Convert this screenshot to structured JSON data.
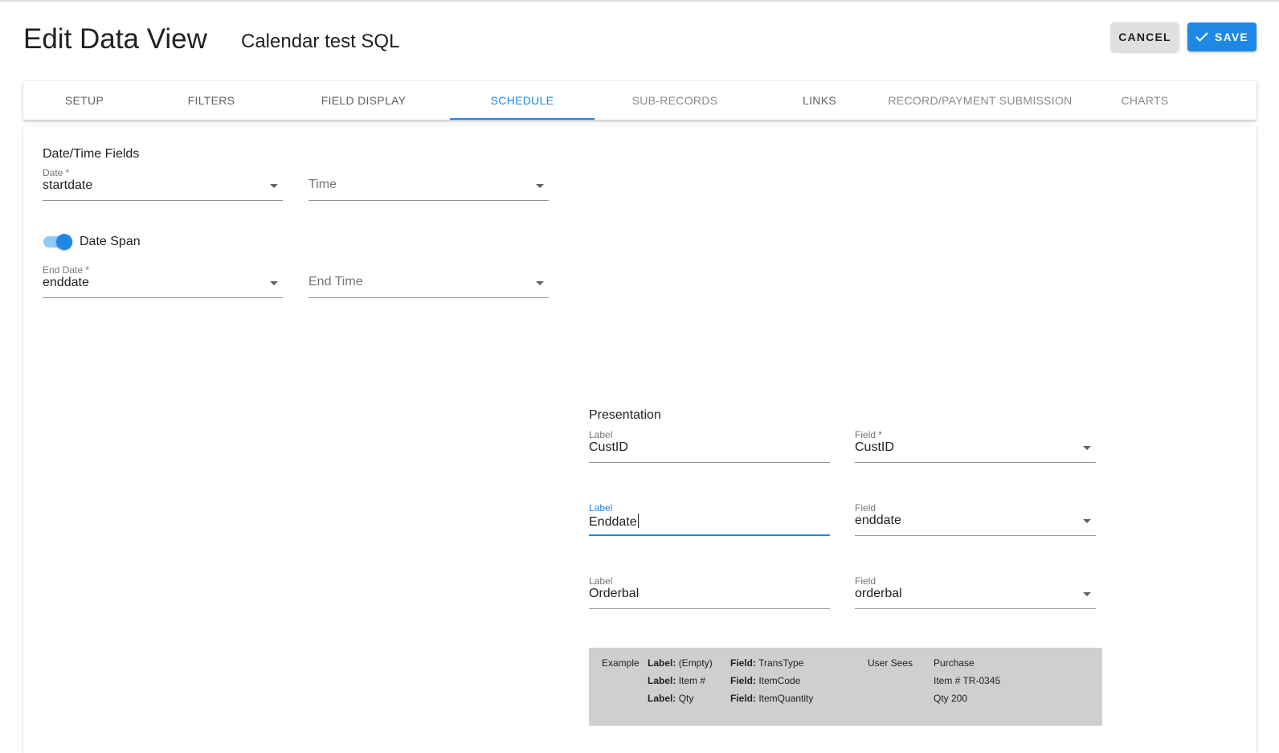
{
  "header": {
    "page_title": "Edit Data View",
    "view_name": "Calendar test SQL",
    "cancel_label": "CANCEL",
    "save_label": "SAVE"
  },
  "tabs": [
    {
      "label": "SETUP"
    },
    {
      "label": "FILTERS"
    },
    {
      "label": "FIELD DISPLAY"
    },
    {
      "label": "SCHEDULE",
      "active": true
    },
    {
      "label": "SUB-RECORDS"
    },
    {
      "label": "LINKS"
    },
    {
      "label": "RECORD/PAYMENT SUBMISSION"
    },
    {
      "label": "CHARTS"
    }
  ],
  "datetime": {
    "section_title": "Date/Time Fields",
    "date_label": "Date *",
    "date_value": "startdate",
    "time_placeholder": "Time",
    "date_span_label": "Date Span",
    "date_span_on": true,
    "end_date_label": "End Date *",
    "end_date_value": "enddate",
    "end_time_placeholder": "End Time"
  },
  "presentation": {
    "section_title": "Presentation",
    "rows": [
      {
        "label_caption": "Label",
        "label_value": "CustID",
        "field_caption": "Field *",
        "field_value": "CustID"
      },
      {
        "label_caption": "Label",
        "label_value": "Enddate",
        "field_caption": "Field",
        "field_value": "enddate",
        "focused": true
      },
      {
        "label_caption": "Label",
        "label_value": "Orderbal",
        "field_caption": "Field",
        "field_value": "orderbal"
      }
    ]
  },
  "example": {
    "example_caption": "Example",
    "label_prefix": "Label:",
    "field_prefix": "Field:",
    "user_sees_caption": "User Sees",
    "rows": [
      {
        "label": "(Empty)",
        "field": "TransType",
        "sees": "Purchase"
      },
      {
        "label": "Item #",
        "field": "ItemCode",
        "sees": "Item # TR-0345"
      },
      {
        "label": "Qty",
        "field": "ItemQuantity",
        "sees": "Qty 200"
      }
    ]
  },
  "colors": {
    "accent": "#1e88e5",
    "toggle_track": "#90caf9",
    "example_bg": "#cfcfcf"
  }
}
